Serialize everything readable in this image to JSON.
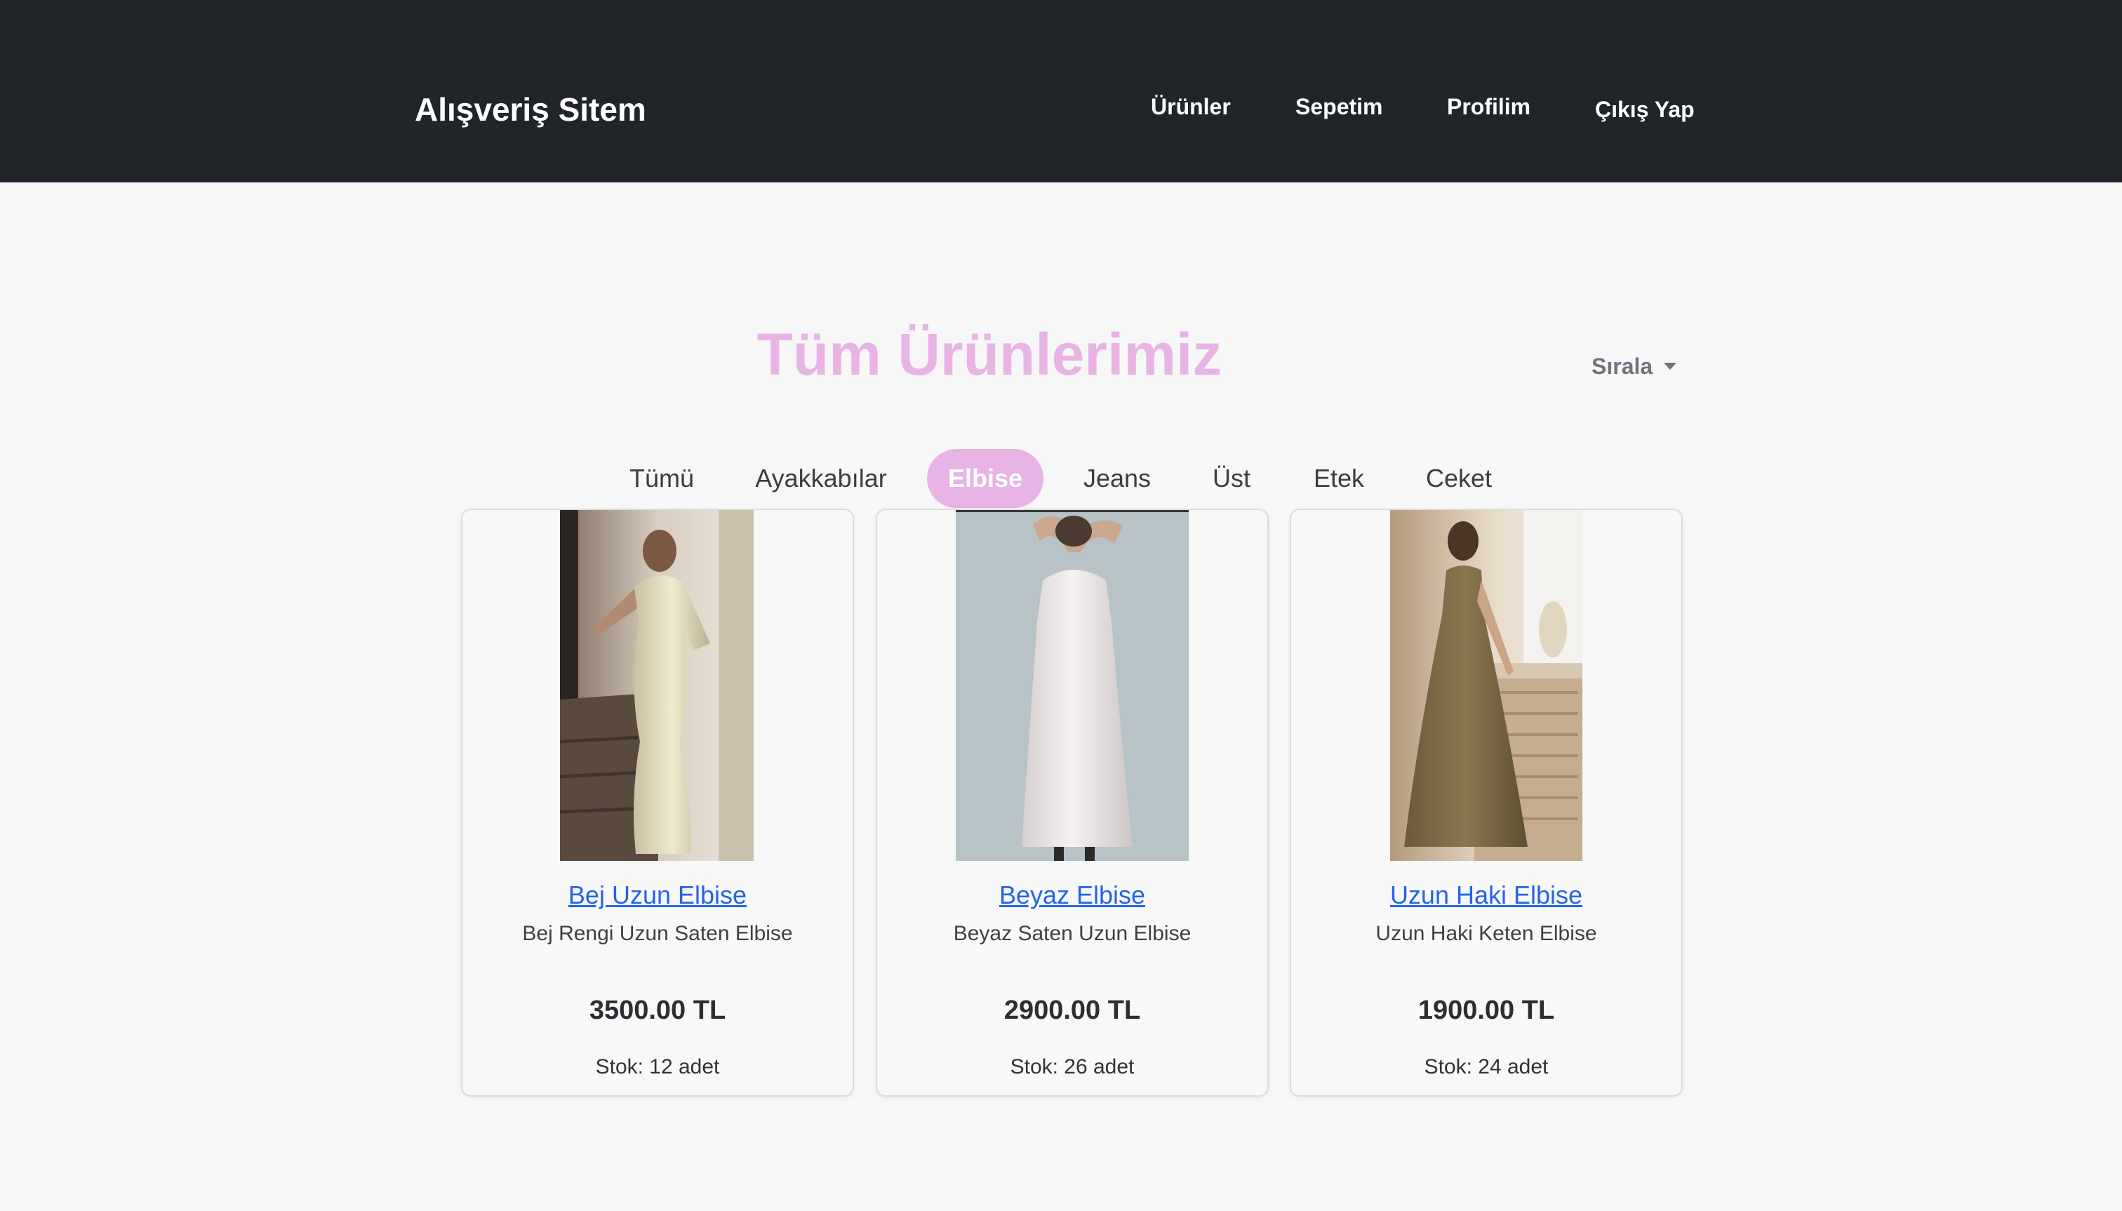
{
  "navbar": {
    "brand": "Alışveriş Sitem",
    "links": [
      "Ürünler",
      "Sepetim",
      "Profilim",
      "Çıkış Yap"
    ]
  },
  "main": {
    "title": "Tüm Ürünlerimiz",
    "sort_label": "Sırala",
    "categories": [
      "Tümü",
      "Ayakkabılar",
      "Elbise",
      "Jeans",
      "Üst",
      "Etek",
      "Ceket"
    ],
    "active_category": "Elbise",
    "products": [
      {
        "name": "Bej Uzun Elbise",
        "description": "Bej Rengi Uzun Saten Elbise",
        "price": "3500.00 TL",
        "stock": "Stok: 12 adet"
      },
      {
        "name": "Beyaz Elbise",
        "description": "Beyaz Saten Uzun Elbise",
        "price": "2900.00 TL",
        "stock": "Stok: 26 adet"
      },
      {
        "name": "Uzun Haki Elbise",
        "description": "Uzun Haki Keten Elbise",
        "price": "1900.00 TL",
        "stock": "Stok: 24 adet"
      }
    ]
  },
  "colors": {
    "navbar_bg": "#212529",
    "accent_pink": "#e8b4e6",
    "link_blue": "#2563eb"
  }
}
